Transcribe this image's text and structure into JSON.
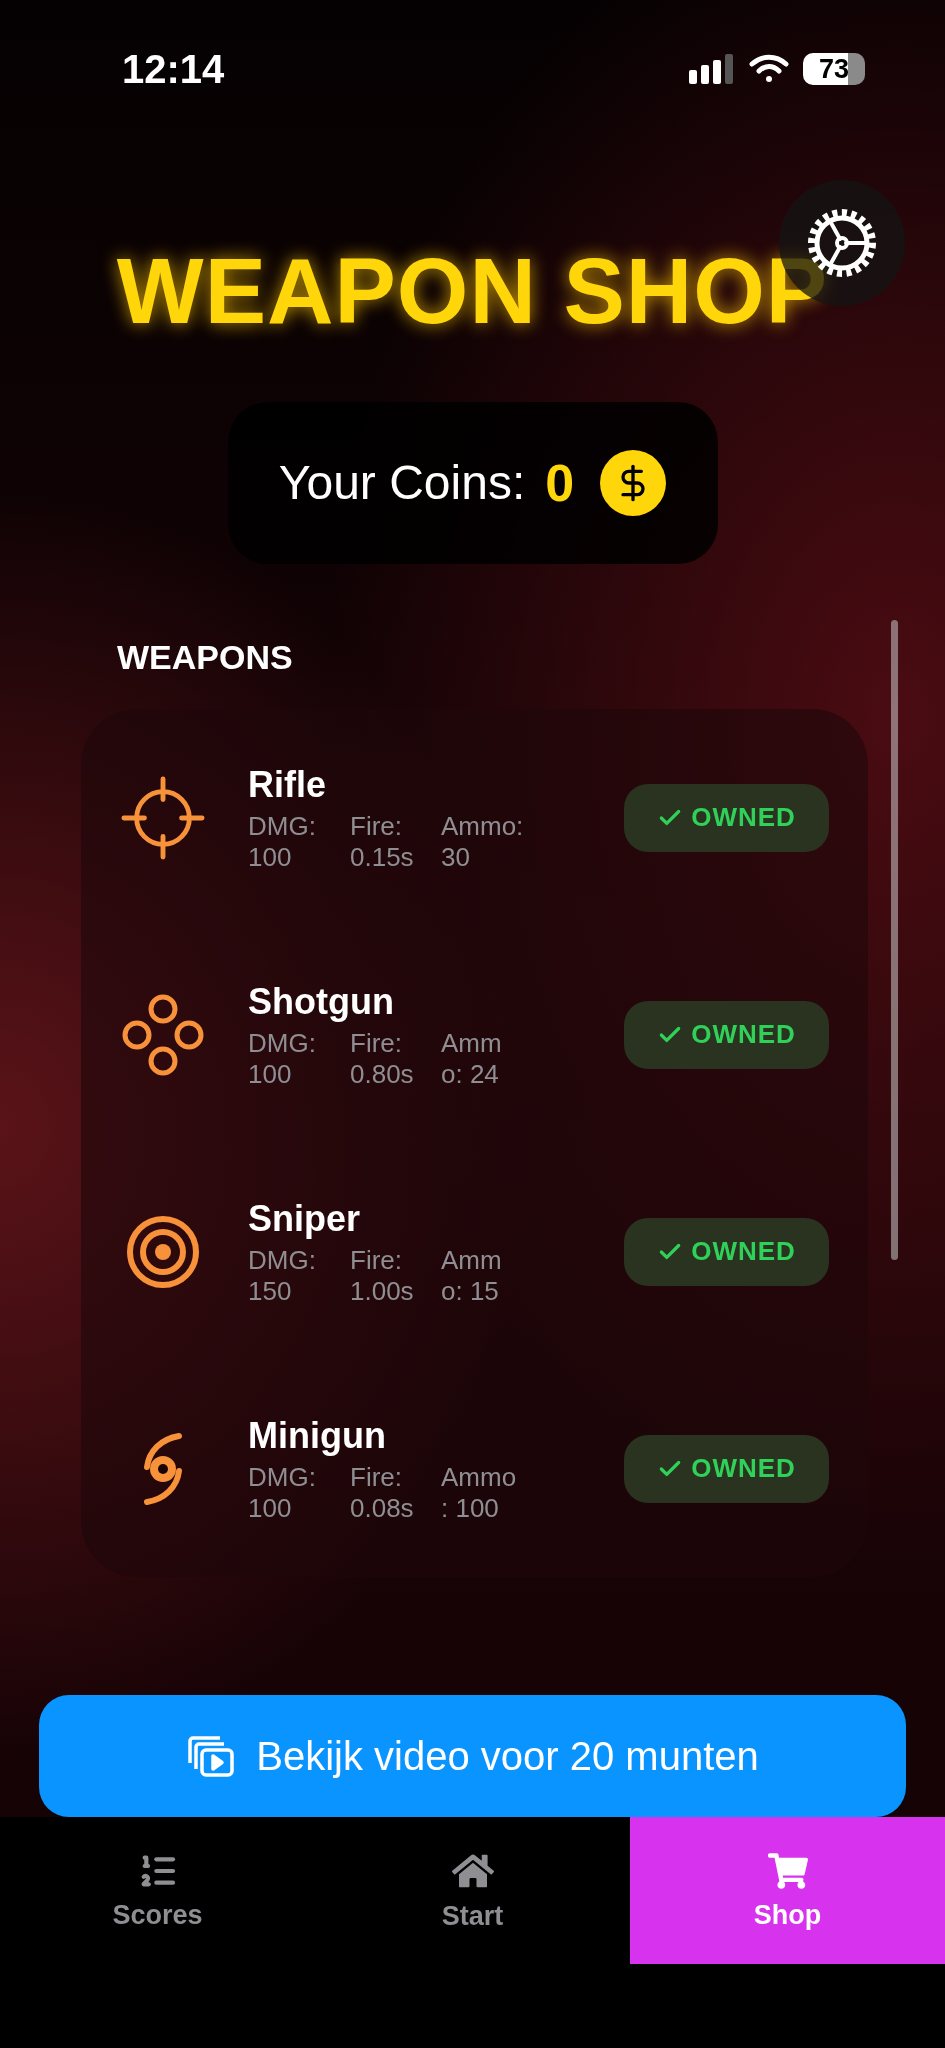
{
  "status_bar": {
    "time": "12:14",
    "battery": "73"
  },
  "title": "WEAPON SHOP",
  "coins": {
    "label": "Your Coins:",
    "value": "0"
  },
  "section_title": "WEAPONS",
  "weapons": [
    {
      "name": "Rifle",
      "stats": [
        {
          "label": "DMG:",
          "value": "100"
        },
        {
          "label": "Fire:",
          "value": "0.15s"
        },
        {
          "label": "Ammo:",
          "value": "30"
        }
      ],
      "owned": true,
      "button": "OWNED"
    },
    {
      "name": "Shotgun",
      "stats": [
        {
          "label": "DMG:",
          "value": "100"
        },
        {
          "label": "Fire:",
          "value": "0.80s"
        },
        {
          "label": "Amm",
          "value": "o: 24"
        }
      ],
      "owned": true,
      "button": "OWNED"
    },
    {
      "name": "Sniper",
      "stats": [
        {
          "label": "DMG:",
          "value": "150"
        },
        {
          "label": "Fire:",
          "value": "1.00s"
        },
        {
          "label": "Amm",
          "value": "o: 15"
        }
      ],
      "owned": true,
      "button": "OWNED"
    },
    {
      "name": "Minigun",
      "stats": [
        {
          "label": "DMG:",
          "value": "100"
        },
        {
          "label": "Fire:",
          "value": "0.08s"
        },
        {
          "label": "Ammo",
          "value": ": 100"
        }
      ],
      "owned": true,
      "button": "OWNED"
    }
  ],
  "video_button": "Bekijk video voor 20 munten",
  "tabs": [
    {
      "label": "Scores",
      "selected": false
    },
    {
      "label": "Start",
      "selected": false
    },
    {
      "label": "Shop",
      "selected": true
    }
  ]
}
